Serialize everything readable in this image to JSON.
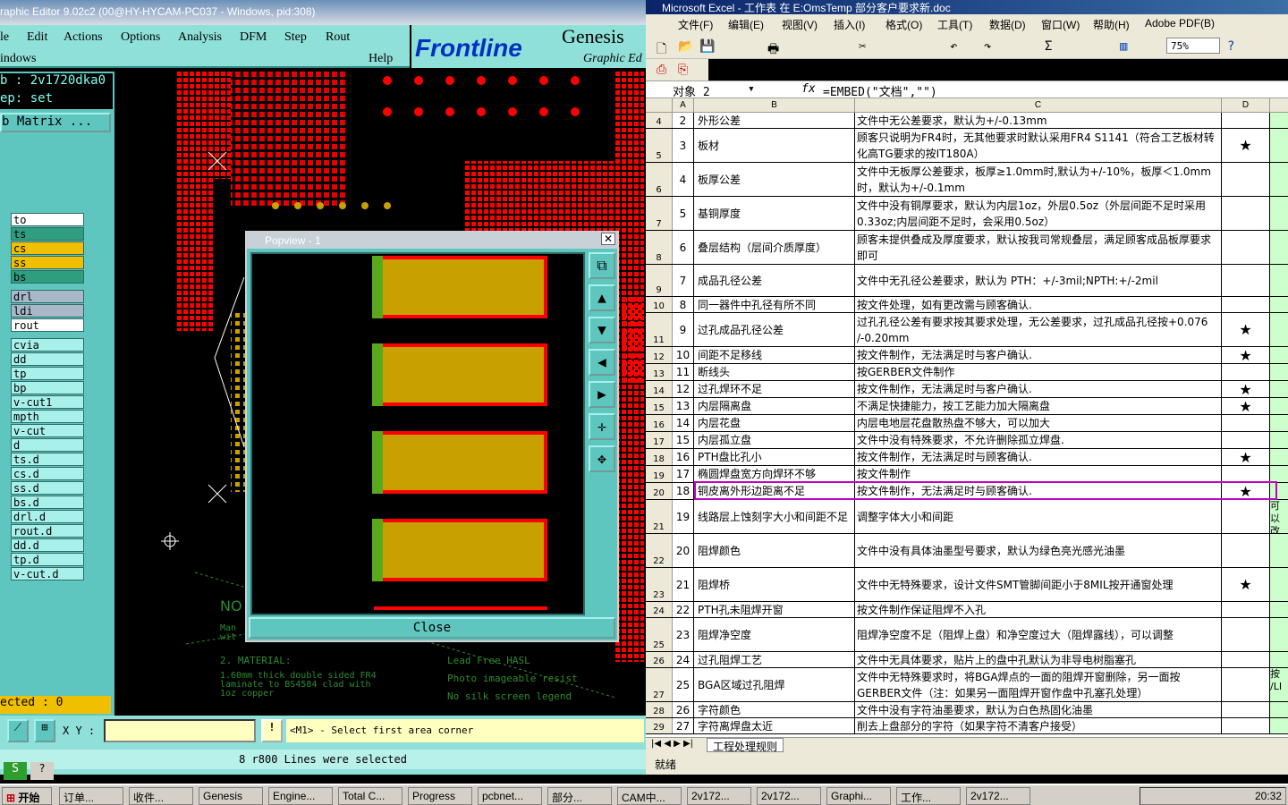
{
  "genesis": {
    "title": "raphic Editor 9.02c2 (00@HY-HYCAM-PC037 - Windows, pid:308)",
    "menu": [
      "le",
      "Edit",
      "Actions",
      "Options",
      "Analysis",
      "DFM",
      "Step",
      "Rout"
    ],
    "menu2": [
      "indows",
      "Help"
    ],
    "logo": "Frontline",
    "brand": "Genesis",
    "brand_sub": "Graphic Ed",
    "job_field": "b : 2v1720dka0",
    "step_field": "ep: set",
    "matrix_button": "b Matrix ...",
    "layers": [
      {
        "name": "to",
        "color": "#ffffff"
      },
      {
        "name": "ts",
        "color": "#2e9e7e"
      },
      {
        "name": "cs",
        "color": "#f0c000"
      },
      {
        "name": "ss",
        "color": "#f0c000"
      },
      {
        "name": "bs",
        "color": "#2e9e7e"
      },
      {
        "name": "drl",
        "color": "#a8b8c8"
      },
      {
        "name": "ldi",
        "color": "#a8b8c8"
      },
      {
        "name": "rout",
        "color": "#ffffff"
      },
      {
        "name": "cvia",
        "color": "#a8f0ea"
      },
      {
        "name": "dd",
        "color": "#a8f0ea"
      },
      {
        "name": "tp",
        "color": "#a8f0ea"
      },
      {
        "name": "bp",
        "color": "#a8f0ea"
      },
      {
        "name": "v-cut1",
        "color": "#a8f0ea"
      },
      {
        "name": "mpth",
        "color": "#a8f0ea"
      },
      {
        "name": "v-cut",
        "color": "#a8f0ea"
      },
      {
        "name": "d",
        "color": "#a8f0ea"
      },
      {
        "name": "ts.d",
        "color": "#a8f0ea"
      },
      {
        "name": "cs.d",
        "color": "#a8f0ea"
      },
      {
        "name": "ss.d",
        "color": "#a8f0ea"
      },
      {
        "name": "bs.d",
        "color": "#a8f0ea"
      },
      {
        "name": "drl.d",
        "color": "#a8f0ea"
      },
      {
        "name": "rout.d",
        "color": "#a8f0ea"
      },
      {
        "name": "dd.d",
        "color": "#a8f0ea"
      },
      {
        "name": "tp.d",
        "color": "#a8f0ea"
      },
      {
        "name": "v-cut.d",
        "color": "#a8f0ea"
      }
    ],
    "selected_label": "ected : 0",
    "xy_label": "X Y :",
    "prompt": "<M1> - Select first area corner",
    "status": "8 r800 Lines were selected",
    "canvas_notes": {
      "no": "NO",
      "material": "2. MATERIAL:",
      "mat1": "1.60mm thick double sided FR4",
      "mat2": "laminate to BS4584 clad with",
      "mat3": "1oz copper",
      "lead": "Lead Free HASL",
      "photo": "Photo imageable resist",
      "silk": "No silk screen legend",
      "man": "Man",
      "wit": "wit"
    }
  },
  "popview": {
    "title": "Popview - 1",
    "close_label": "Close"
  },
  "excel": {
    "title": "Microsoft Excel - 工作表 在 E:OmsTemp 部分客户要求新.doc",
    "menu": [
      "文件(F)",
      "编辑(E)",
      "视图(V)",
      "插入(I)",
      "格式(O)",
      "工具(T)",
      "数据(D)",
      "窗口(W)",
      "帮助(H)",
      "Adobe PDF(B)"
    ],
    "zoom": "75%",
    "name_box": "对象 2",
    "fx": "fx",
    "formula": "=EMBED(\"文档\",\"\")",
    "columns": [
      "A",
      "B",
      "C",
      "D"
    ],
    "rows": [
      {
        "rh": "4",
        "a": "2",
        "b": "外形公差",
        "c": "文件中无公差要求，默认为+/-0.13mm",
        "d": "",
        "e": "",
        "h": 18
      },
      {
        "rh": "5",
        "a": "3",
        "b": "板材",
        "c": "顾客只说明为FR4时，无其他要求时默认采用FR4 S1141（符合工艺板材转化高TG要求的按IT180A）",
        "d": "★",
        "e": "",
        "h": 38
      },
      {
        "rh": "6",
        "a": "4",
        "b": "板厚公差",
        "c": "文件中无板厚公差要求，板厚≥1.0mm时,默认为+/-10%，板厚＜1.0mm时，默认为+/-0.1mm",
        "d": "",
        "e": "",
        "h": 38
      },
      {
        "rh": "7",
        "a": "5",
        "b": "基铜厚度",
        "c": "文件中没有铜厚要求，默认为内层1oz，外层0.5oz（外层间距不足时采用0.33oz;内层间距不足时，会采用0.5oz）",
        "d": "",
        "e": "",
        "h": 38
      },
      {
        "rh": "8",
        "a": "6",
        "b": "叠层结构（层间介质厚度）",
        "c": "顾客未提供叠成及厚度要求，默认按我司常规叠层，满足顾客成品板厚要求即可",
        "d": "",
        "e": "",
        "h": 38
      },
      {
        "rh": "9",
        "a": "7",
        "b": "成品孔径公差",
        "c": "文件中无孔径公差要求，默认为 PTH：+/-3mil;NPTH:+/-2mil",
        "d": "",
        "e": "",
        "h": 36
      },
      {
        "rh": "10",
        "a": "8",
        "b": "同一器件中孔径有所不同",
        "c": "按文件处理，如有更改需与顾客确认.",
        "d": "",
        "e": "",
        "h": 18
      },
      {
        "rh": "11",
        "a": "9",
        "b": "过孔成品孔径公差",
        "c": "过孔孔径公差有要求按其要求处理，无公差要求，过孔成品孔径按+0.076 /-0.20mm",
        "d": "★",
        "e": "",
        "h": 38
      },
      {
        "rh": "12",
        "a": "10",
        "b": "间距不足移线",
        "c": "按文件制作，无法满足时与客户确认.",
        "d": "★",
        "e": "",
        "h": 19
      },
      {
        "rh": "13",
        "a": "11",
        "b": "断线头",
        "c": "按GERBER文件制作",
        "d": "",
        "e": "",
        "h": 19
      },
      {
        "rh": "14",
        "a": "12",
        "b": "过孔焊环不足",
        "c": "按文件制作，无法满足时与客户确认.",
        "d": "★",
        "e": "",
        "h": 19
      },
      {
        "rh": "15",
        "a": "13",
        "b": "内层隔离盘",
        "c": "不满足快捷能力，按工艺能力加大隔离盘",
        "d": "★",
        "e": "",
        "h": 19
      },
      {
        "rh": "16",
        "a": "14",
        "b": "内层花盘",
        "c": "内层电地层花盘散热盘不够大，可以加大",
        "d": "",
        "e": "",
        "h": 19
      },
      {
        "rh": "17",
        "a": "15",
        "b": "内层孤立盘",
        "c": "文件中没有特殊要求，不允许删除孤立焊盘.",
        "d": "",
        "e": "",
        "h": 19
      },
      {
        "rh": "18",
        "a": "16",
        "b": "PTH盘比孔小",
        "c": "按文件制作，无法满足时与顾客确认.",
        "d": "★",
        "e": "",
        "h": 19
      },
      {
        "rh": "19",
        "a": "17",
        "b": "椭圆焊盘宽方向焊环不够",
        "c": "按文件制作",
        "d": "",
        "e": "",
        "h": 19
      },
      {
        "rh": "20",
        "a": "18",
        "b": "铜皮离外形边距离不足",
        "c": "按文件制作，无法满足时与顾客确认.",
        "d": "★",
        "e": "",
        "h": 19
      },
      {
        "rh": "21",
        "a": "19",
        "b": "线路层上蚀刻字大小和间距不足",
        "c": "调整字体大小和间距",
        "d": "",
        "e": "可以 改变 按",
        "h": 38
      },
      {
        "rh": "22",
        "a": "20",
        "b": "阻焊颜色",
        "c": "文件中没有具体油墨型号要求，默认为绿色亮光感光油墨",
        "d": "",
        "e": "",
        "h": 38
      },
      {
        "rh": "23",
        "a": "21",
        "b": "阻焊桥",
        "c": "文件中无特殊要求，设计文件SMT管脚间距小于8MIL按开通窗处理",
        "d": "★",
        "e": "",
        "h": 38
      },
      {
        "rh": "24",
        "a": "22",
        "b": "PTH孔未阻焊开窗",
        "c": "按文件制作保证阻焊不入孔",
        "d": "",
        "e": "",
        "h": 18
      },
      {
        "rh": "25",
        "a": "23",
        "b": "阻焊净空度",
        "c": "阻焊净空度不足（阻焊上盘）和净空度过大（阻焊露线），可以调整",
        "d": "",
        "e": "",
        "h": 38
      },
      {
        "rh": "26",
        "a": "24",
        "b": "过孔阻焊工艺",
        "c": "文件中无具体要求，贴片上的盘中孔默认为非导电树脂塞孔",
        "d": "",
        "e": "",
        "h": 18
      },
      {
        "rh": "27",
        "a": "25",
        "b": "BGA区域过孔阻焊",
        "c": "文件中无特殊要求时，将BGA焊点的一面的阻焊开窗删除，另一面按GERBER文件（注：如果另一面阻焊开窗作盘中孔塞孔处理）",
        "d": "",
        "e": "按 /LI",
        "h": 38
      },
      {
        "rh": "28",
        "a": "26",
        "b": "字符颜色",
        "c": "文件中没有字符油墨要求，默认为白色热固化油墨",
        "d": "",
        "e": "",
        "h": 18
      },
      {
        "rh": "29",
        "a": "27",
        "b": "字符离焊盘太近",
        "c": "削去上盘部分的字符（如果字符不清客户接受）",
        "d": "",
        "e": "",
        "h": 18
      }
    ],
    "sheet_tab": "工程处理规则",
    "status": "就绪"
  },
  "taskbar": {
    "start": "开始",
    "items": [
      "订单...",
      "收件...",
      "Genesis",
      "Engine...",
      "Total C...",
      "Progress",
      "pcbnet...",
      "部分...",
      "CAM中...",
      "2v172...",
      "2v172...",
      "Graphi...",
      "工作...",
      "2v172..."
    ],
    "clock": "20:32"
  },
  "colors": {
    "genesis_panel": "#8fe0d8",
    "excel_bg": "#ece9d8",
    "pad_red": "#ff0000",
    "pad_gold": "#c8a000"
  }
}
